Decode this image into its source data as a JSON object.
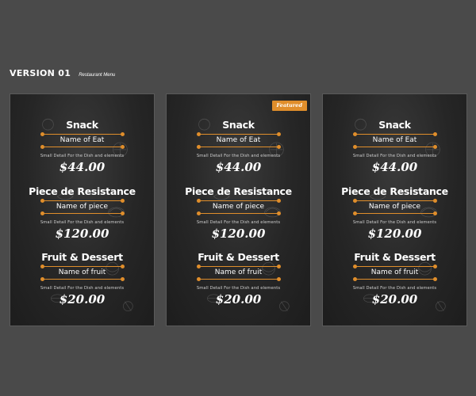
{
  "header": {
    "version": "VERSION 01",
    "subtitle": "Restaurant Menu"
  },
  "colors": {
    "accent": "#e08e2b",
    "background": "#4a4a4a",
    "card": "#262626"
  },
  "badge": {
    "featured": "Featured"
  },
  "cards": [
    {
      "sections": [
        {
          "title": "Snack",
          "name": "Name of Eat",
          "detail": "Small Detail For the Dish and elements",
          "price": "$44.00"
        },
        {
          "title": "Piece de Resistance",
          "name": "Name of piece",
          "detail": "Small Detail For the Dish and elements",
          "price": "$120.00"
        },
        {
          "title": "Fruit & Dessert",
          "name": "Name of fruit",
          "detail": "Small Detail For the Dish and elements",
          "price": "$20.00"
        }
      ]
    },
    {
      "sections": [
        {
          "title": "Snack",
          "name": "Name of Eat",
          "detail": "Small Detail For the Dish and elements",
          "price": "$44.00"
        },
        {
          "title": "Piece de Resistance",
          "name": "Name of piece",
          "detail": "Small Detail For the Dish and elements",
          "price": "$120.00"
        },
        {
          "title": "Fruit & Dessert",
          "name": "Name of fruit",
          "detail": "Small Detail For the Dish and elements",
          "price": "$20.00"
        }
      ]
    },
    {
      "sections": [
        {
          "title": "Snack",
          "name": "Name of Eat",
          "detail": "Small Detail For the Dish and elements",
          "price": "$44.00"
        },
        {
          "title": "Piece de Resistance",
          "name": "Name of piece",
          "detail": "Small Detail For the Dish and elements",
          "price": "$120.00"
        },
        {
          "title": "Fruit & Dessert",
          "name": "Name of fruit",
          "detail": "Small Detail For the Dish and elements",
          "price": "$20.00"
        }
      ]
    }
  ]
}
